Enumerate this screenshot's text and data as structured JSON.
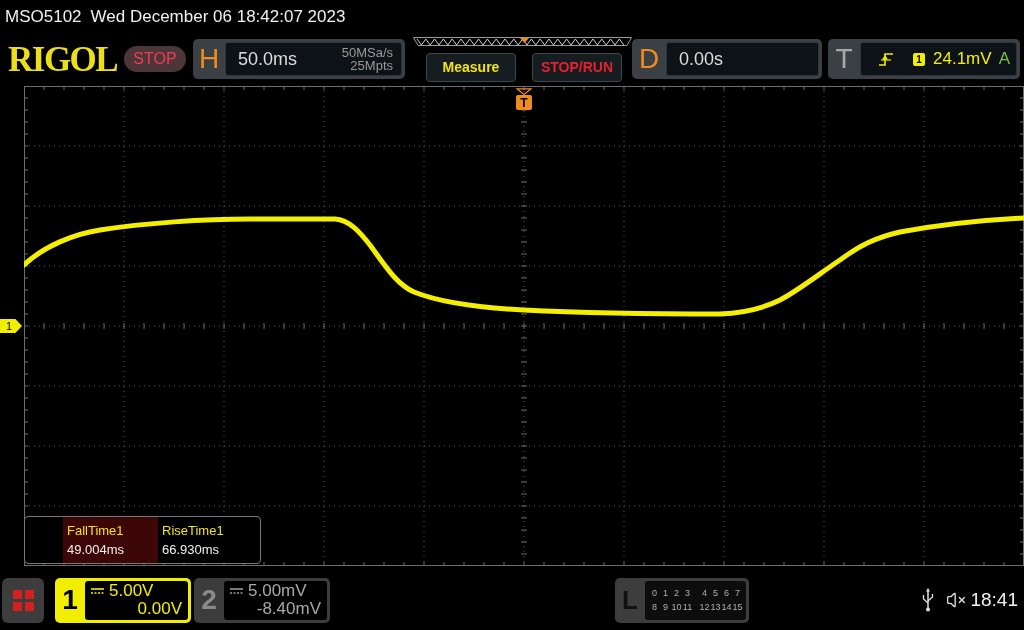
{
  "status_line": {
    "model": "MSO5102",
    "datetime": "Wed December 06 18:42:07 2023"
  },
  "header": {
    "logo": "RIGOL",
    "run_state": "STOP",
    "horizontal": {
      "label": "H",
      "timebase": "50.0ms",
      "sample_rate": "50MSa/s",
      "memory_depth": "25Mpts"
    },
    "buttons": [
      {
        "kind": "measure",
        "label": "Measure"
      },
      {
        "kind": "run_stop",
        "label": "STOP/RUN"
      }
    ],
    "delay": {
      "label": "D",
      "value": "0.00s"
    },
    "trigger": {
      "label": "T",
      "source": "1",
      "threshold": "24.1mV",
      "mode": "A"
    }
  },
  "screen": {
    "trigger_marker": "T",
    "channel_marker": "1"
  },
  "measurements": [
    {
      "name": "FallTime1",
      "value": "49.004ms",
      "selected": true
    },
    {
      "name": "RiseTime1",
      "value": "66.930ms",
      "selected": false
    }
  ],
  "channels": [
    {
      "number": "1",
      "scale": "5.00V",
      "offset": "0.00V",
      "on": true
    },
    {
      "number": "2",
      "scale": "5.00mV",
      "offset": "-8.40mV",
      "on": false
    }
  ],
  "logic": {
    "label": "L",
    "rows": [
      [
        "0",
        "1",
        "2",
        "3",
        "4",
        "5",
        "6",
        "7"
      ],
      [
        "8",
        "9",
        "10",
        "11",
        "12",
        "13",
        "14",
        "15"
      ]
    ]
  },
  "system_time": "18:41"
}
